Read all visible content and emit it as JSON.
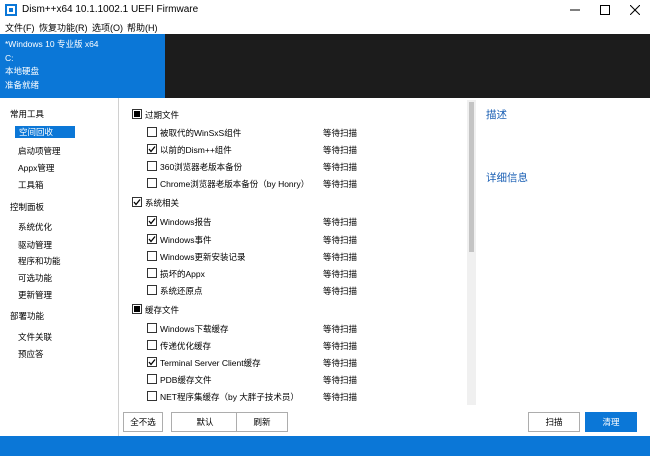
{
  "window": {
    "title": "Dism++x64 10.1.1002.1 UEFI Firmware"
  },
  "menu": [
    "文件(F)",
    "恢复功能(R)",
    "选项(O)",
    "帮助(H)"
  ],
  "info": {
    "system": "*Windows 10 专业版 x64",
    "drive": "C:",
    "disk": "本地硬盘",
    "status": "准备就绪"
  },
  "sidebar": {
    "categories": [
      {
        "label": "常用工具",
        "items": [
          "空间回收",
          "启动项管理",
          "Appx管理",
          "工具箱"
        ]
      },
      {
        "label": "控制面板",
        "items": [
          "系统优化",
          "驱动管理",
          "程序和功能",
          "可选功能",
          "更新管理"
        ]
      },
      {
        "label": "部署功能",
        "items": [
          "文件关联",
          "预应答"
        ]
      }
    ],
    "selected": "空间回收"
  },
  "groups": [
    {
      "label": "过期文件",
      "state": "indeterminate",
      "items": [
        {
          "label": "被取代的WinSxS组件",
          "checked": false,
          "status": "等待扫描"
        },
        {
          "label": "以前的Dism++组件",
          "checked": true,
          "status": "等待扫描"
        },
        {
          "label": "360浏览器老版本备份",
          "checked": false,
          "status": "等待扫描"
        },
        {
          "label": "Chrome浏览器老版本备份（by Honry）",
          "checked": false,
          "status": "等待扫描"
        }
      ]
    },
    {
      "label": "系统相关",
      "state": "checked",
      "items": [
        {
          "label": "Windows报告",
          "checked": true,
          "status": "等待扫描"
        },
        {
          "label": "Windows事件",
          "checked": true,
          "status": "等待扫描"
        },
        {
          "label": "Windows更新安装记录",
          "checked": false,
          "status": "等待扫描"
        },
        {
          "label": "损坏的Appx",
          "checked": false,
          "status": "等待扫描"
        },
        {
          "label": "系统还原点",
          "checked": false,
          "status": "等待扫描"
        }
      ]
    },
    {
      "label": "缓存文件",
      "state": "indeterminate",
      "items": [
        {
          "label": "Windows下载缓存",
          "checked": false,
          "status": "等待扫描"
        },
        {
          "label": "传递优化缓存",
          "checked": false,
          "status": "等待扫描"
        },
        {
          "label": "Terminal Server Client缓存",
          "checked": true,
          "status": "等待扫描"
        },
        {
          "label": "PDB缓存文件",
          "checked": false,
          "status": "等待扫描"
        },
        {
          "label": "NET程序集缓存（by 大胖子技术员）",
          "checked": false,
          "status": "等待扫描"
        }
      ]
    }
  ],
  "right_panel": {
    "description_title": "描述",
    "details_title": "详细信息"
  },
  "buttons": {
    "deselect_all": "全不选",
    "default": "默认",
    "refresh": "刷新",
    "scan": "扫描",
    "clean": "清理"
  },
  "colors": {
    "accent": "#0b77d7",
    "console": "#1c1c1c"
  }
}
